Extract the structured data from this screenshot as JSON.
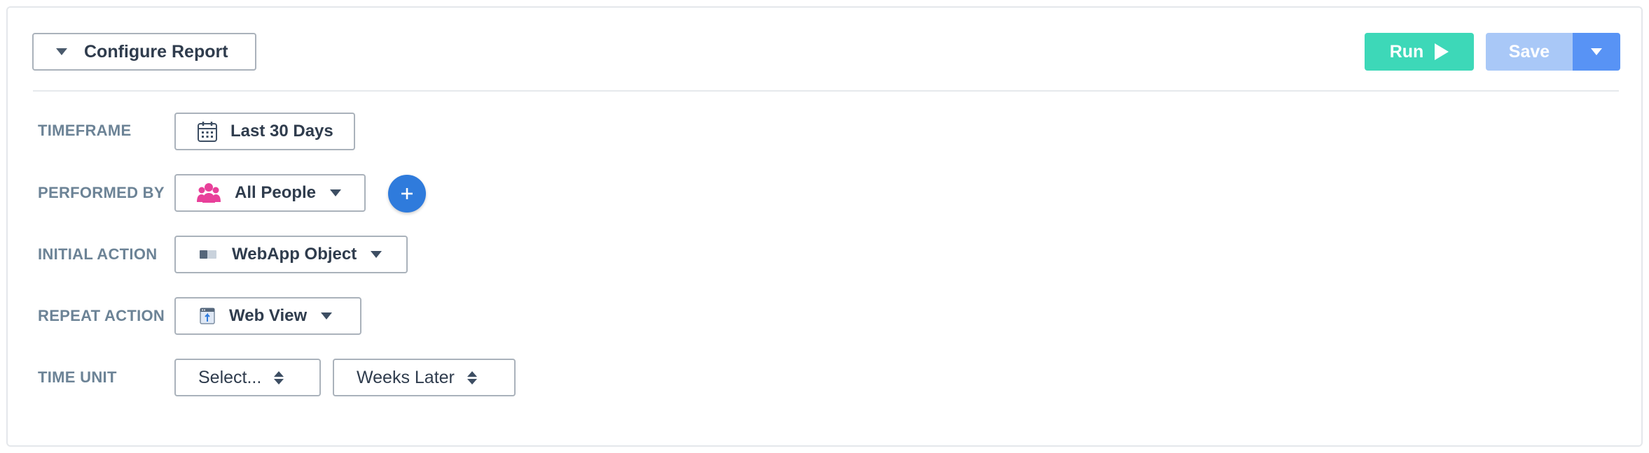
{
  "header": {
    "configure_label": "Configure Report",
    "run_label": "Run",
    "save_label": "Save"
  },
  "rows": {
    "timeframe": {
      "label": "TIMEFRAME",
      "value": "Last 30 Days",
      "icon": "calendar-icon"
    },
    "performed_by": {
      "label": "PERFORMED BY",
      "value": "All People",
      "icon": "people-icon"
    },
    "initial_action": {
      "label": "INITIAL ACTION",
      "value": "WebApp Object",
      "icon": "webapp-object-icon"
    },
    "repeat_action": {
      "label": "REPEAT ACTION",
      "value": "Web View",
      "icon": "web-view-icon"
    },
    "time_unit": {
      "label": "TIME UNIT",
      "select_value": "Select...",
      "later_value": "Weeks Later"
    }
  },
  "colors": {
    "run": "#3dd8b8",
    "save": "#a9c8f7",
    "save_dropdown": "#5893f5",
    "add": "#2f7bdc",
    "people_icon": "#e8409a",
    "label": "#6c8396"
  }
}
